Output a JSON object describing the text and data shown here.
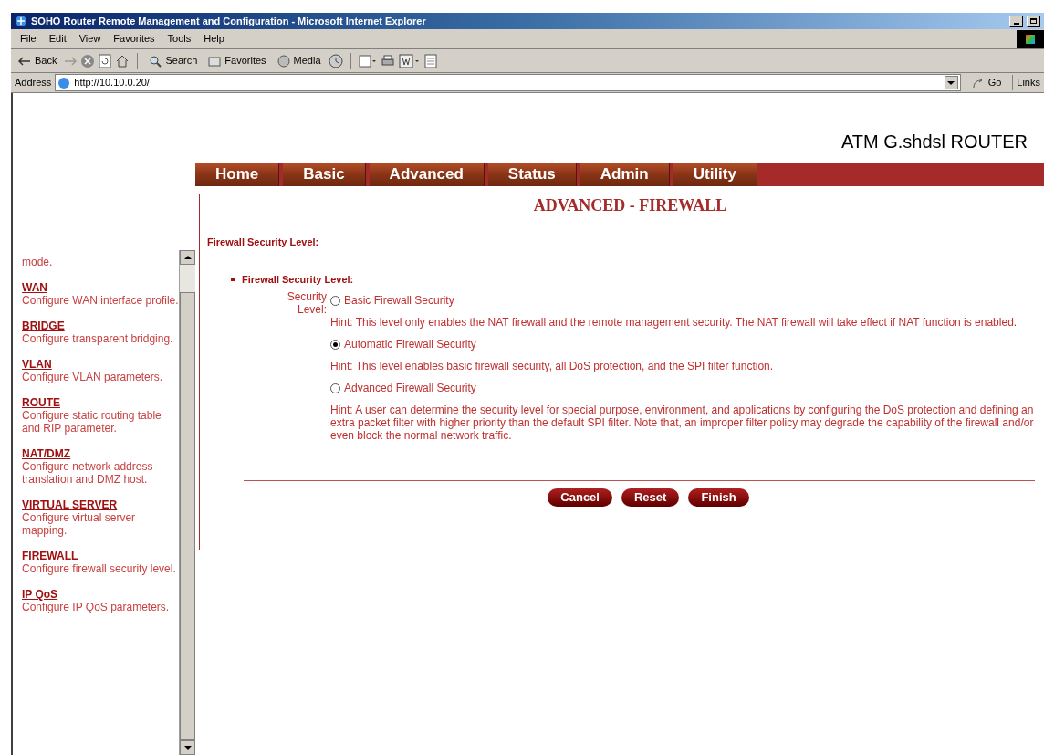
{
  "window": {
    "title": "SOHO Router Remote Management and Configuration - Microsoft Internet Explorer"
  },
  "menu": [
    "File",
    "Edit",
    "View",
    "Favorites",
    "Tools",
    "Help"
  ],
  "toolbar": {
    "back": "Back",
    "search": "Search",
    "favorites": "Favorites",
    "media": "Media"
  },
  "address": {
    "label": "Address",
    "value": "http://10.10.0.20/",
    "go": "Go",
    "links": "Links"
  },
  "header": {
    "product": "ATM G.shdsl ROUTER"
  },
  "nav": [
    {
      "label": "Home",
      "selected": false
    },
    {
      "label": "Basic",
      "selected": false
    },
    {
      "label": "Advanced",
      "selected": false
    },
    {
      "label": "Status",
      "selected": false
    },
    {
      "label": "Admin",
      "selected": false
    },
    {
      "label": "Utility",
      "selected": false
    }
  ],
  "sidebar": {
    "items": [
      {
        "description": "mode."
      },
      {
        "title": "WAN",
        "description": "Configure WAN interface profile."
      },
      {
        "title": "BRIDGE",
        "description": "Configure transparent bridging."
      },
      {
        "title": "VLAN",
        "description": "Configure VLAN parameters."
      },
      {
        "title": "ROUTE",
        "description": "Configure static routing table and RIP parameter."
      },
      {
        "title": "NAT/DMZ",
        "description": "Configure network address translation and DMZ host."
      },
      {
        "title": "VIRTUAL SERVER",
        "description": "Configure virtual server mapping."
      },
      {
        "title": "FIREWALL",
        "description": "Configure firewall security level."
      },
      {
        "title": "IP QoS",
        "description": "Configure IP QoS parameters."
      }
    ]
  },
  "page": {
    "title": "ADVANCED - FIREWALL",
    "section": "Firewall Security Level:",
    "subsection": "Firewall Security Level:",
    "field_label": "Security Level:",
    "options": [
      {
        "label": "Basic Firewall Security",
        "selected": false,
        "hint": "Hint: This level only enables the NAT firewall and the remote management security. The NAT firewall will take effect if NAT function is enabled."
      },
      {
        "label": "Automatic Firewall Security",
        "selected": true,
        "hint": "Hint: This level enables basic firewall security, all DoS protection, and the SPI filter function."
      },
      {
        "label": "Advanced Firewall Security",
        "selected": false,
        "hint": "Hint: A user can determine the security level for special purpose, environment, and applications by configuring the DoS protection and defining an extra packet filter with higher priority than the default SPI filter. Note that, an improper filter policy may degrade the capability of the firewall and/or even block the normal network traffic."
      }
    ]
  },
  "buttons": [
    "Cancel",
    "Reset",
    "Finish"
  ]
}
